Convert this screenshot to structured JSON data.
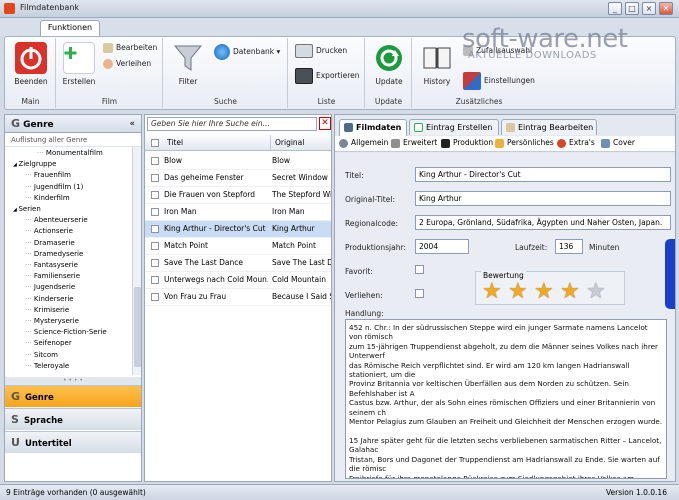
{
  "window": {
    "title": "Filmdatenbank",
    "controls": [
      "_",
      "□",
      "×",
      "✕"
    ],
    "icon_color": "#e2471a"
  },
  "ribbon": {
    "tab": "Funktionen",
    "groups": {
      "main": {
        "label": "Main",
        "beenden": "Beenden"
      },
      "film": {
        "label": "Film",
        "erstellen": "Erstellen",
        "bearbeiten": "Bearbeiten",
        "verleihen": "Verleihen"
      },
      "suche": {
        "label": "Suche",
        "filter": "Filter",
        "datenbank": "Datenbank"
      },
      "liste": {
        "label": "Liste",
        "drucken": "Drucken",
        "exportieren": "Exportieren"
      },
      "update": {
        "label": "Update",
        "update": "Update"
      },
      "zusaetzliches": {
        "label": "Zusätzliches",
        "history": "History",
        "zufallsauswahl": "Zufallsauswahl",
        "einstellungen": "Einstellungen"
      }
    }
  },
  "watermark": {
    "line1": "soft-ware.net",
    "line2": "AKTUELLE DOWNLOADS"
  },
  "left": {
    "header": "Genre",
    "header_letter": "G",
    "collapse_glyph": "«",
    "subtitle": "Auflistung aller Genre",
    "tree": [
      {
        "label": "Monumentalfilm",
        "level": 2
      },
      {
        "label": "Zielgruppe",
        "level": 0
      },
      {
        "label": "Frauenfilm",
        "level": 1
      },
      {
        "label": "Jugendfilm (1)",
        "level": 1
      },
      {
        "label": "Kinderfilm",
        "level": 1
      },
      {
        "label": "Serien",
        "level": 0
      },
      {
        "label": "Abenteuerserie",
        "level": 1
      },
      {
        "label": "Actionserie",
        "level": 1
      },
      {
        "label": "Dramaserie",
        "level": 1
      },
      {
        "label": "Dramedyserie",
        "level": 1
      },
      {
        "label": "Fantasyserie",
        "level": 1
      },
      {
        "label": "Familienserie",
        "level": 1
      },
      {
        "label": "Jugendserie",
        "level": 1
      },
      {
        "label": "Kinderserie",
        "level": 1
      },
      {
        "label": "Krimiserie",
        "level": 1
      },
      {
        "label": "Mysteryserie",
        "level": 1
      },
      {
        "label": "Science-Fiction-Serie",
        "level": 1
      },
      {
        "label": "Seifenoper",
        "level": 1
      },
      {
        "label": "Sitcom",
        "level": 1
      },
      {
        "label": "Teleroyale",
        "level": 1
      }
    ],
    "nav": [
      {
        "letter": "G",
        "label": "Genre",
        "active": true
      },
      {
        "letter": "S",
        "label": "Sprache",
        "active": false
      },
      {
        "letter": "U",
        "label": "Untertitel",
        "active": false
      }
    ],
    "active_color": "#f7a21b"
  },
  "list": {
    "search_placeholder": "Geben Sie hier Ihre Suche ein...",
    "clear_glyph": "✕",
    "columns": [
      "Titel",
      "Original"
    ],
    "rows": [
      {
        "title": "Blow",
        "original": "Blow",
        "selected": false
      },
      {
        "title": "Das geheime Fenster",
        "original": "Secret Window",
        "selected": false
      },
      {
        "title": "Die Frauen von Stepford",
        "original": "The Stepford Wiv",
        "selected": false
      },
      {
        "title": "Iron Man",
        "original": "Iron Man",
        "selected": false
      },
      {
        "title": "King Arthur - Director's Cut",
        "original": "King Arthur",
        "selected": true
      },
      {
        "title": "Match Point",
        "original": "Match Point",
        "selected": false
      },
      {
        "title": "Save The Last Dance",
        "original": "Save The Last D",
        "selected": false
      },
      {
        "title": "Unterwegs nach Cold Moun...",
        "original": "Cold Mountain",
        "selected": false
      },
      {
        "title": "Von Frau zu Frau",
        "original": "Because I Said S",
        "selected": false
      }
    ],
    "selected_color": "#c9dcf3"
  },
  "detail": {
    "tabs": [
      "Filmdaten",
      "Eintrag Erstellen",
      "Eintrag Bearbeiten"
    ],
    "subtabs": [
      "Allgemein",
      "Erweitert",
      "Produktion",
      "Persönliches",
      "Extra's",
      "Cover"
    ],
    "fields": {
      "titel_label": "Titel:",
      "titel": "King Arthur - Director's Cut",
      "original_label": "Original-Titel:",
      "original": "King Arthur",
      "region_label": "Regionalcode:",
      "region": "2 Europa, Grönland, Südafrika, Ägypten und Naher Osten, Japan.",
      "jahr_label": "Produktionsjahr:",
      "jahr": "2004",
      "laufzeit_label": "Laufzeit:",
      "laufzeit": "136",
      "minuten": "Minuten",
      "favorit_label": "Favorit:",
      "verliehen_label": "Verliehen:",
      "bewertung_label": "Bewertung",
      "rating": 4,
      "rating_max": 5,
      "handlung_label": "Handlung:",
      "handlung": "452 n. Chr.: In der südrussischen Steppe wird ein junger Sarmate namens Lancelot von römisch\nzum 15-jährigen Truppendienst abgeholt, zu dem die Männer seines Volkes nach ihrer Unterwerf\ndas Römische Reich verpflichtet sind. Er wird am 120 km langen Hadrianswall stationiert, um die\nProvinz Britannia vor keltischen Überfällen aus dem Norden zu schützen. Sein Befehlshaber ist A\nCastus bzw. Arthur, der als Sohn eines römischen Offiziers und einer Britannierin von seinem ch\nMentor Pelagius zum Glauben an Freiheit und Gleichheit der Menschen erzogen wurde.\n\n15 Jahre später geht für die letzten sechs verbliebenen sarmatischen Ritter – Lancelot, Galahac\nTristan, Bors und Dagonet der Truppendienst am Hadrianswall zu Ende. Sie warten auf die römisc\nFreibriefe für ihre monatelange Rückreise zum Siedlungsgebiet ihres Volkes am Schwarzen Meer.\n\nDer aus Rom ankommende Bischof Germanius hat diese Papiere dabei – allerdings auch eine letz\nfür die kleine Truppe unter ihrem Kommandanten Artorius: Der römische Papst höchstpersönlich\nsein Patenkind und zukünftigen Papst Alecto aus dem Feindesland im Norden zurückholen, der\nHadrianswall zu bringen. Von Germanius erfahren die Ritter auch, dass ein großes Heer der Sac"
    }
  },
  "status": {
    "left": "9 Einträge vorhanden (0 ausgewählt)",
    "right": "Version 1.0.0.16"
  }
}
